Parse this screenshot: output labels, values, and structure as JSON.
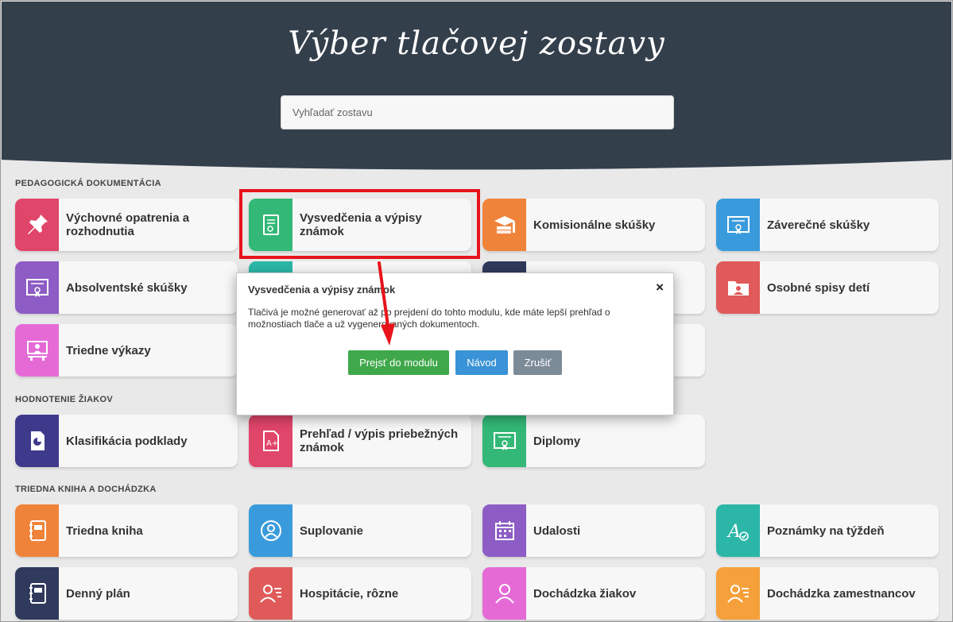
{
  "header": {
    "title": "Výber tlačovej zostavy",
    "search_placeholder": "Vyhľadať zostavu"
  },
  "sections": {
    "pedagogicka": "PEDAGOGICKÁ DOKUMENTÁCIA",
    "hodnotenie": "HODNOTENIE ŽIAKOV",
    "triedna": "TRIEDNA KNIHA A DOCHÁDZKA"
  },
  "tiles": {
    "vychovne": {
      "label": "Výchovné opatrenia a rozhodnutia",
      "color": "#e0456a",
      "icon": "pin-icon"
    },
    "vysvedcenia": {
      "label": "Vysvedčenia a výpisy známok",
      "color": "#33b877",
      "icon": "certificate-icon"
    },
    "komisionalne": {
      "label": "Komisionálne skúšky",
      "color": "#f0833a",
      "icon": "graduation-icon"
    },
    "zaverecne": {
      "label": "Záverečné skúšky",
      "color": "#3a9bdc",
      "icon": "diploma-icon"
    },
    "absolventske": {
      "label": "Absolventské skúšky",
      "color": "#8d5cc4",
      "icon": "diploma-icon"
    },
    "osobne": {
      "label": "Osobné spisy detí",
      "color": "#e05a5a",
      "icon": "folder-user-icon"
    },
    "triedne_vykazy": {
      "label": "Triedne výkazy",
      "color": "#e56ad6",
      "icon": "classroom-icon"
    },
    "klasifikacia": {
      "label": "Klasifikácia podklady",
      "color": "#3d3a8c",
      "icon": "chart-doc-icon"
    },
    "prehlad": {
      "label": "Prehľad / výpis priebežných známok",
      "color": "#e0456a",
      "icon": "grade-doc-icon"
    },
    "diplomy": {
      "label": "Diplomy",
      "color": "#33b877",
      "icon": "diploma-icon"
    },
    "triedna_kniha": {
      "label": "Triedna kniha",
      "color": "#f0833a",
      "icon": "notebook-icon"
    },
    "suplovanie": {
      "label": "Suplovanie",
      "color": "#3a9bdc",
      "icon": "user-circle-icon"
    },
    "udalosti": {
      "label": "Udalosti",
      "color": "#8d5cc4",
      "icon": "calendar-icon"
    },
    "poznamky": {
      "label": "Poznámky na týždeň",
      "color": "#2bb6a8",
      "icon": "letter-check-icon"
    },
    "denny_plan": {
      "label": "Denný plán",
      "color": "#2f3a5c",
      "icon": "notebook-icon"
    },
    "hospitacie": {
      "label": "Hospitácie, rôzne",
      "color": "#e05a5a",
      "icon": "user-list-icon"
    },
    "dochadzka_ziakov": {
      "label": "Dochádzka žiakov",
      "color": "#e56ad6",
      "icon": "user-icon"
    },
    "dochadzka_zam": {
      "label": "Dochádzka zamestnancov",
      "color": "#f5a03a",
      "icon": "user-list-icon"
    },
    "hidden_teal": {
      "color": "#2bb6a8"
    },
    "hidden_navy": {
      "color": "#2f3a5c"
    }
  },
  "modal": {
    "title": "Vysvedčenia a výpisy známok",
    "close": "×",
    "body": "Tlačivá je možné generovať až po prejdení do tohto modulu, kde máte lepší prehľad o možnostiach tlače a už vygenerovaných dokumentoch.",
    "btn_go": "Prejsť do modulu",
    "btn_help": "Návod",
    "btn_cancel": "Zrušiť"
  }
}
